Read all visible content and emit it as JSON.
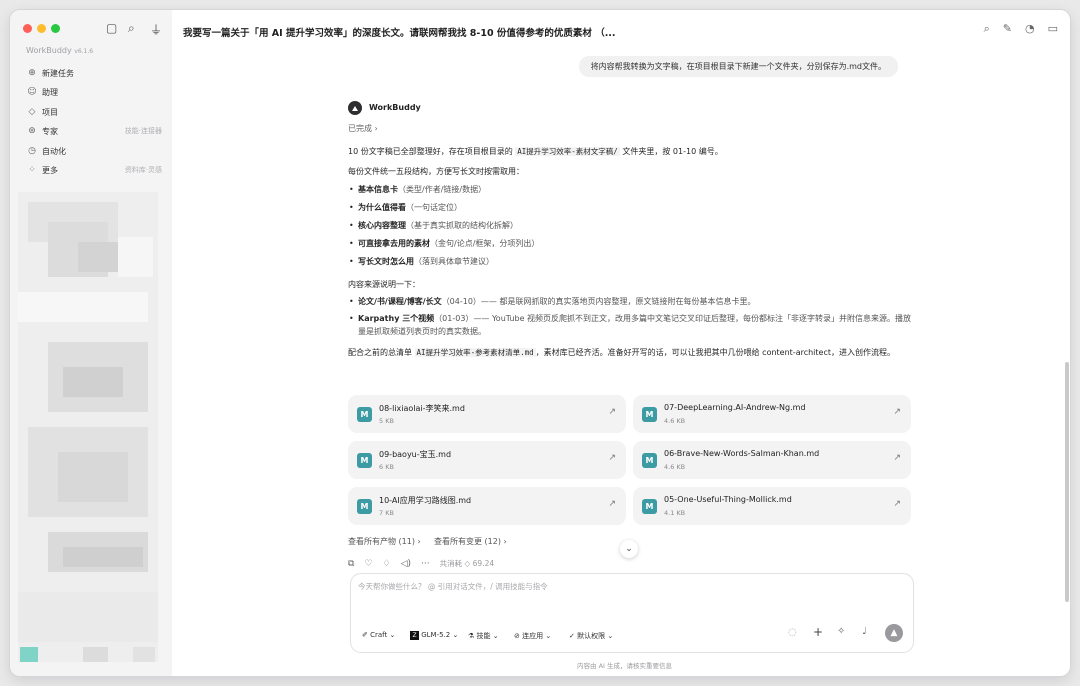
{
  "app": {
    "name": "WorkBuddy",
    "version": "v6.1.6"
  },
  "sidebar": {
    "items": [
      {
        "icon": "plus-circle-icon",
        "label": "新建任务",
        "hint": ""
      },
      {
        "icon": "assistant-icon",
        "label": "助理",
        "hint": ""
      },
      {
        "icon": "project-icon",
        "label": "项目",
        "hint": ""
      },
      {
        "icon": "expert-icon",
        "label": "专家",
        "hint": "技能·连接器"
      },
      {
        "icon": "automation-icon",
        "label": "自动化",
        "hint": ""
      },
      {
        "icon": "more-icon",
        "label": "更多",
        "hint": "资料库·灵感"
      }
    ]
  },
  "header": {
    "title": "我要写一篇关于「用 AI 提升学习效率」的深度长文。请联网帮我找 8-10 份值得参考的优质素材 （..."
  },
  "conversation": {
    "user_message": "将内容帮我转换为文字稿，在项目根目录下新建一个文件夹，分别保存为.md文件。",
    "assistant_name": "WorkBuddy",
    "status": "已完成",
    "intro": {
      "pre": "10 份文字稿已全部整理好，存在项目根目录的 ",
      "code": "AI提升学习效率-素材文字稿/",
      "post": " 文件夹里，按 01-10 编号。"
    },
    "structure_heading": "每份文件统一五段结构，方便写长文时按需取用：",
    "structure_items": [
      {
        "bold": "基本信息卡",
        "rest": "（类型/作者/链接/数据）"
      },
      {
        "bold": "为什么值得看",
        "rest": "（一句话定位）"
      },
      {
        "bold": "核心内容整理",
        "rest": "（基于真实抓取的结构化拆解）"
      },
      {
        "bold": "可直接拿去用的素材",
        "rest": "（金句/论点/框架，分项列出）"
      },
      {
        "bold": "写长文时怎么用",
        "rest": "（落到具体章节建议）"
      }
    ],
    "source_heading": "内容来源说明一下：",
    "source_items": [
      {
        "bold": "论文/书/课程/博客/长文",
        "rest": "（04-10）—— 都是联网抓取的真实落地页内容整理，原文链接附在每份基本信息卡里。"
      },
      {
        "bold": "Karpathy 三个视频",
        "rest": "（01-03）—— YouTube 视频页反爬抓不到正文，改用多篇中文笔记交叉印证后整理，每份都标注「非逐字转录」并附信息来源。播放量是抓取频道列表页时的真实数据。"
      }
    ],
    "closing": {
      "pre": "配合之前的总清单 ",
      "code": "AI提升学习效率-参考素材清单.md",
      "post": "，素材库已经齐活。准备好开写的话，可以让我把其中几份喂给 content-architect，进入创作流程。"
    },
    "files": [
      {
        "name": "08-lixiaolai-李笑来.md",
        "size": "5 KB"
      },
      {
        "name": "07-DeepLearning.AI-Andrew-Ng.md",
        "size": "4.6 KB"
      },
      {
        "name": "09-baoyu-宝玉.md",
        "size": "6 KB"
      },
      {
        "name": "06-Brave-New-Words-Salman-Khan.md",
        "size": "4.6 KB"
      },
      {
        "name": "10-AI应用学习路线图.md",
        "size": "7 KB"
      },
      {
        "name": "05-One-Useful-Thing-Mollick.md",
        "size": "4.1 KB"
      }
    ],
    "links": {
      "all_outputs": "查看所有产物 (11) ›",
      "all_changes": "查看所有变更 (12) ›"
    },
    "cost": "共消耗 ◇ 69.24"
  },
  "composer": {
    "placeholder": "今天帮你做些什么？ @ 引用对话文件，/ 调用技能与指令",
    "craft": "Craft",
    "model": "GLM-5.2",
    "skills": "技能",
    "apps": "连应用",
    "permission": "默认权限",
    "footer": "内容由 AI 生成，请核实重要信息"
  },
  "colors": {
    "accent": "#3d9ba4",
    "traffic_red": "#fe5f57",
    "traffic_yellow": "#febc2e",
    "traffic_green": "#28c840"
  }
}
